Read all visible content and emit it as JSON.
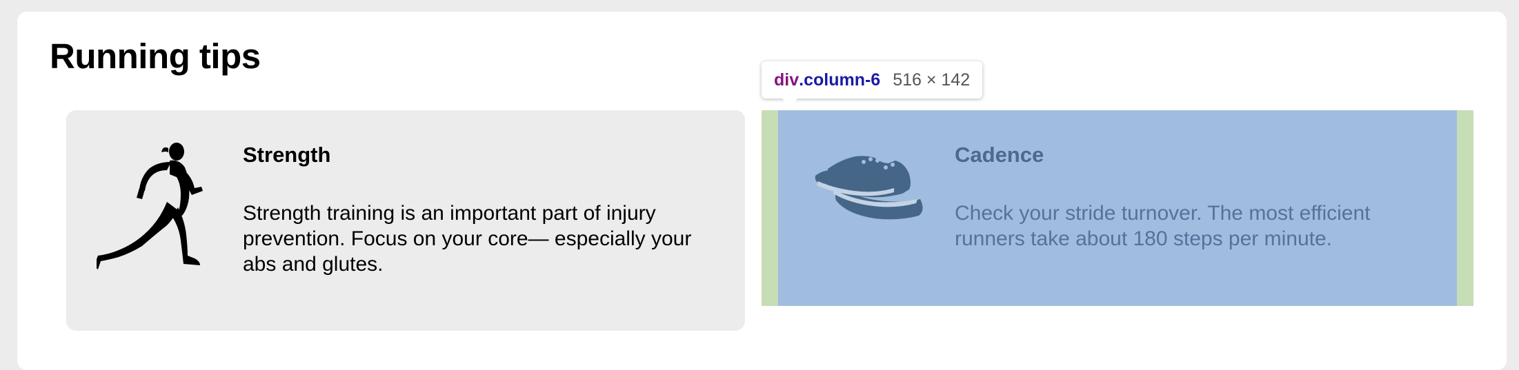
{
  "page": {
    "title": "Running tips"
  },
  "tips": [
    {
      "title": "Strength",
      "body": "Strength training is an important part of injury prevention. Focus on your core— especially your abs and glutes.",
      "icon": "runner-icon"
    },
    {
      "title": "Cadence",
      "body": "Check your stride turnover. The most efficient runners take about 180 steps per minute.",
      "icon": "sneakers-icon"
    }
  ],
  "inspector": {
    "tag": "div",
    "class_name": ".column-6",
    "size": "516 × 142",
    "colors": {
      "content": "#a0bddf",
      "margin": "#c6ddb6"
    }
  }
}
